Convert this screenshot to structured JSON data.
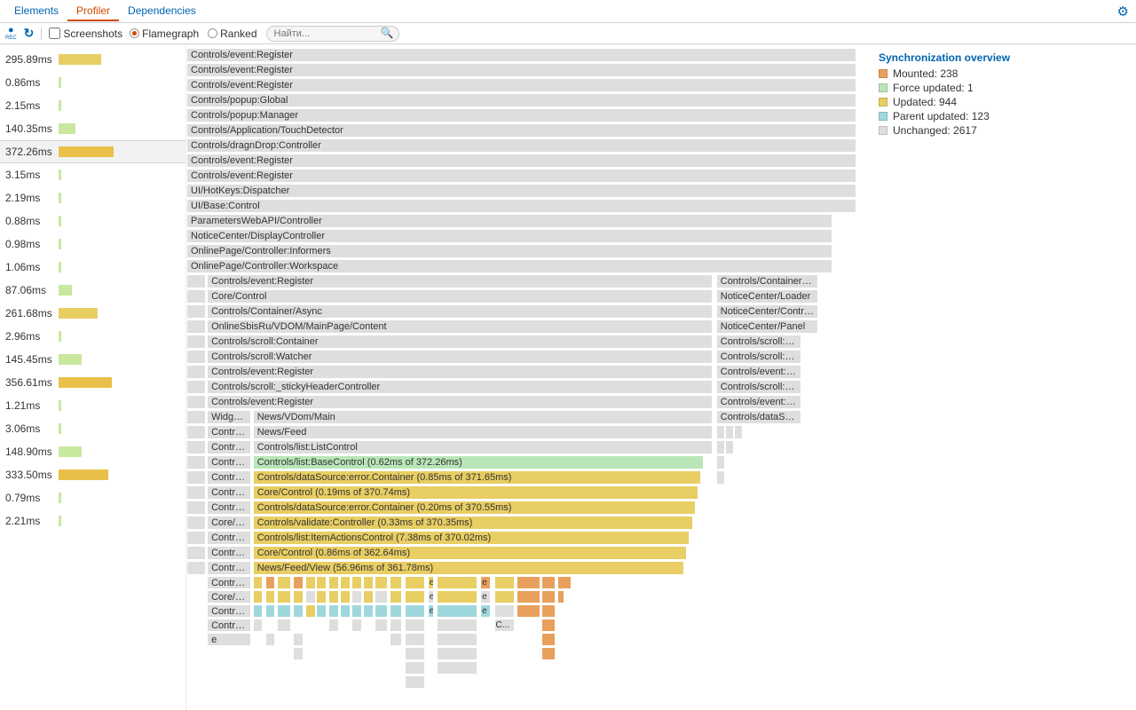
{
  "tabs": {
    "elements": "Elements",
    "profiler": "Profiler",
    "dependencies": "Dependencies"
  },
  "toolbar": {
    "rec_label": "REC",
    "screenshots": "Screenshots",
    "flamegraph": "Flamegraph",
    "ranked": "Ranked",
    "search_placeholder": "Найти..."
  },
  "commits": [
    {
      "ms": "295.89ms",
      "pct": 35,
      "color": "#e8ce63"
    },
    {
      "ms": "0.86ms",
      "pct": 2,
      "color": "#c9e89f"
    },
    {
      "ms": "2.15ms",
      "pct": 2,
      "color": "#c9e89f"
    },
    {
      "ms": "140.35ms",
      "pct": 14,
      "color": "#c9e89f"
    },
    {
      "ms": "372.26ms",
      "pct": 45,
      "color": "#e8c04a",
      "selected": true
    },
    {
      "ms": "3.15ms",
      "pct": 2,
      "color": "#c9e89f"
    },
    {
      "ms": "2.19ms",
      "pct": 2,
      "color": "#c9e89f"
    },
    {
      "ms": "0.88ms",
      "pct": 2,
      "color": "#c9e89f"
    },
    {
      "ms": "0.98ms",
      "pct": 2,
      "color": "#c9e89f"
    },
    {
      "ms": "1.06ms",
      "pct": 2,
      "color": "#c9e89f"
    },
    {
      "ms": "87.06ms",
      "pct": 11,
      "color": "#c9e89f"
    },
    {
      "ms": "261.68ms",
      "pct": 32,
      "color": "#e8ce63"
    },
    {
      "ms": "2.96ms",
      "pct": 2,
      "color": "#c9e89f"
    },
    {
      "ms": "145.45ms",
      "pct": 19,
      "color": "#c9e89f"
    },
    {
      "ms": "356.61ms",
      "pct": 44,
      "color": "#e8c04a"
    },
    {
      "ms": "1.21ms",
      "pct": 2,
      "color": "#c9e89f"
    },
    {
      "ms": "3.06ms",
      "pct": 2,
      "color": "#c9e89f"
    },
    {
      "ms": "148.90ms",
      "pct": 19,
      "color": "#c9e89f"
    },
    {
      "ms": "333.50ms",
      "pct": 41,
      "color": "#e8c04a"
    },
    {
      "ms": "0.79ms",
      "pct": 2,
      "color": "#c9e89f"
    },
    {
      "ms": "2.21ms",
      "pct": 2,
      "color": "#c9e89f"
    }
  ],
  "flame": {
    "full": [
      "Controls/event:Register",
      "Controls/event:Register",
      "Controls/event:Register",
      "Controls/popup:Global",
      "Controls/popup:Manager",
      "Controls/Application/TouchDetector",
      "Controls/dragnDrop:Controller",
      "Controls/event:Register",
      "Controls/event:Register",
      "UI/HotKeys:Dispatcher",
      "UI/Base:Control"
    ],
    "slight1": [
      "ParametersWebAPI/Controller",
      "NoticeCenter/DisplayController",
      "OnlinePage/Controller:Informers",
      "OnlinePage/Controller:Workspace"
    ],
    "nested_left": [
      "Controls/event:Register",
      "Core/Control",
      "Controls/Container/Async",
      "OnlineSbisRu/VDOM/MainPage/Content",
      "Controls/scroll:Container",
      "Controls/scroll:Watcher",
      "Controls/event:Register",
      "Controls/scroll:_stickyHeaderController",
      "Controls/event:Register"
    ],
    "nested_right": [
      "Controls/Container/Async",
      "NoticeCenter/Loader",
      "NoticeCenter/Controller",
      "NoticeCenter/Panel",
      "Controls/scroll:Conta...",
      "Controls/scroll:Watc...",
      "Controls/event:Regis...",
      "Controls/scroll:_stic...",
      "Controls/event:Regis...",
      "Controls/dataSource..."
    ],
    "widgets_row": {
      "a": "Widgets...",
      "b": "News/VDom/Main"
    },
    "stack_labels": [
      "Control...",
      "Control...",
      "Control...",
      "Control...",
      "Control...",
      "Control...",
      "Core/C...",
      "Control...",
      "Control..."
    ],
    "news_feed": "News/Feed",
    "list_control": "Controls/list:ListControl",
    "yellow_green": [
      {
        "cls": "green",
        "label": "Controls/list:BaseControl (0.62ms of 372.26ms)"
      },
      {
        "cls": "yellow",
        "label": "Controls/dataSource:error.Container (0.85ms of 371.65ms)"
      },
      {
        "cls": "yellow",
        "label": "Core/Control (0.19ms of 370.74ms)"
      },
      {
        "cls": "yellow",
        "label": "Controls/dataSource:error.Container (0.20ms of 370.55ms)"
      },
      {
        "cls": "yellow",
        "label": "Controls/validate:Controller (0.33ms of 370.35ms)"
      },
      {
        "cls": "yellow",
        "label": "Controls/list:ItemActionsControl (7.38ms of 370.02ms)"
      },
      {
        "cls": "yellow",
        "label": "Core/Control (0.86ms of 362.64ms)"
      },
      {
        "cls": "yellow",
        "label": "News/Feed/View (56.96ms of 361.78ms)"
      }
    ],
    "tail_labels": [
      "Contro...",
      "Core/C...",
      "Contro...",
      "Contro..."
    ],
    "e": "e",
    "c": "C..."
  },
  "legend": {
    "title": "Synchronization overview",
    "items": [
      {
        "label": "Mounted: 238",
        "sw": "orange"
      },
      {
        "label": "Force updated: 1",
        "sw": "green"
      },
      {
        "label": "Updated: 944",
        "sw": "yellow"
      },
      {
        "label": "Parent updated: 123",
        "sw": "teal"
      },
      {
        "label": "Unchanged: 2617",
        "sw": "grey"
      }
    ]
  }
}
